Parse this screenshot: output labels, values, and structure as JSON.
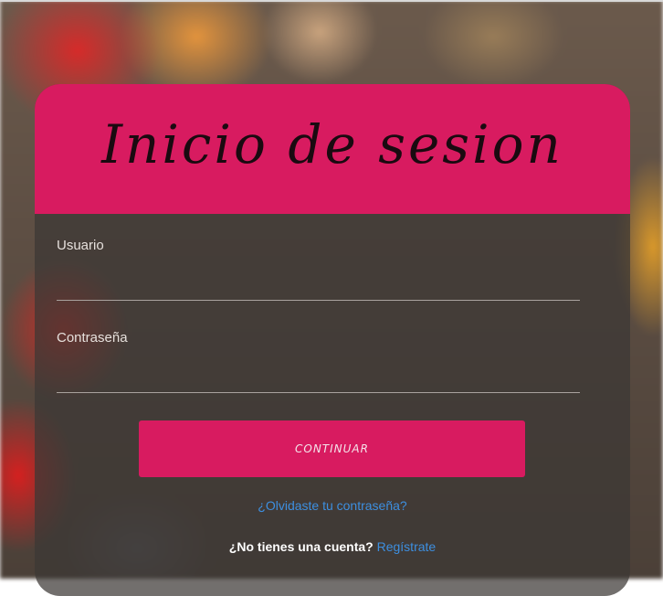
{
  "login": {
    "title": "Inicio de sesion",
    "username_label": "Usuario",
    "username_value": "",
    "password_label": "Contraseña",
    "password_value": "",
    "continue_label": "CONTINUAR",
    "forgot_link": "¿Olvidaste tu contraseña?",
    "signup_question": "¿No tienes una cuenta?",
    "signup_link": "Regístrate"
  },
  "colors": {
    "accent": "#d81b60",
    "link": "#3d8fe0"
  }
}
